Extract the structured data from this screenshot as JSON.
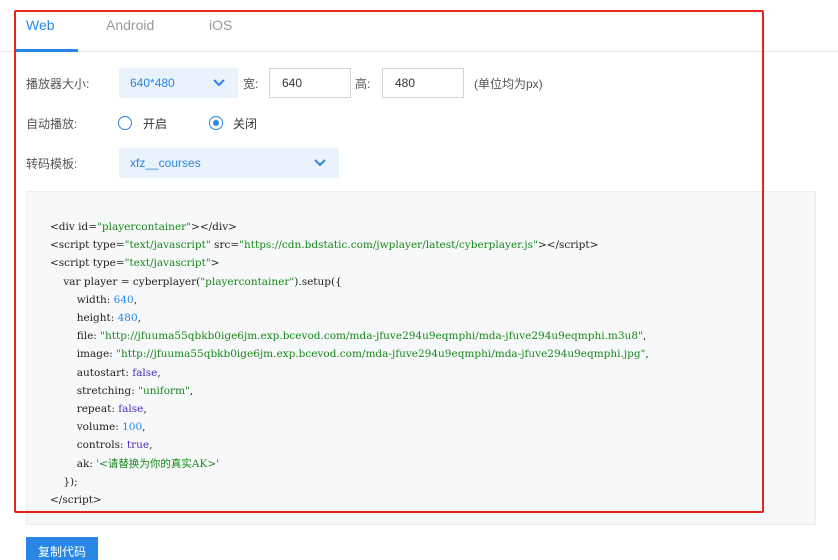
{
  "tabs": [
    {
      "label": "Web",
      "active": true
    },
    {
      "label": "Android",
      "active": false
    },
    {
      "label": "iOS",
      "active": false
    }
  ],
  "form": {
    "size": {
      "label": "播放器大小:",
      "selected": "640*480",
      "width_label": "宽:",
      "width_value": "640",
      "height_label": "高:",
      "height_value": "480",
      "unit_note": "(单位均为px)"
    },
    "autoplay": {
      "label": "自动播放:",
      "options": [
        {
          "label": "开启",
          "checked": false
        },
        {
          "label": "关闭",
          "checked": true
        }
      ]
    },
    "template": {
      "label": "转码模板:",
      "selected": "xfz__courses"
    }
  },
  "code": {
    "div_id": "playercontainer",
    "script_type": "text/javascript",
    "script_src": "https://cdn.bdstatic.com/jwplayer/latest/cyberplayer.js",
    "var_name": "player",
    "setup": {
      "width": "640",
      "height": "480",
      "file": "http://jfuuma55qbkb0ige6jm.exp.bcevod.com/mda-jfuve294u9eqmphi/mda-jfuve294u9eqmphi.m3u8",
      "image": "http://jfuuma55qbkb0ige6jm.exp.bcevod.com/mda-jfuve294u9eqmphi/mda-jfuve294u9eqmphi.jpg",
      "autostart": "false",
      "stretching": "uniform",
      "repeat": "false",
      "volume": "100",
      "controls": "true",
      "ak": "'<请替换为你的真实AK>'"
    }
  },
  "actions": {
    "copy_label": "复制代码"
  },
  "colors": {
    "accent": "#2a86e4",
    "highlight_frame": "#e8231c",
    "code_string": "#18891a",
    "select_bg": "#eaf3fc"
  },
  "icons": {
    "dropdown": "chevron-down-icon"
  }
}
